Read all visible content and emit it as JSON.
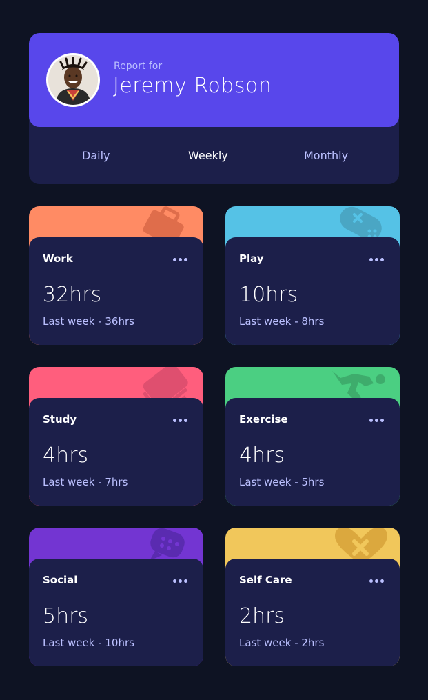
{
  "profile": {
    "report_label": "Report for",
    "name": "Jeremy Robson"
  },
  "tabs": [
    {
      "label": "Daily",
      "active": false
    },
    {
      "label": "Weekly",
      "active": true
    },
    {
      "label": "Monthly",
      "active": false
    }
  ],
  "colors": {
    "background": "#0e1323",
    "card": "#1c1f4a",
    "profile": "#5847eb",
    "pale_blue": "#bbc0ff"
  },
  "activities": [
    {
      "title": "Work",
      "current": "32hrs",
      "previous": "Last week - 36hrs",
      "color": "#ff8b64",
      "icon": "briefcase-icon"
    },
    {
      "title": "Play",
      "current": "10hrs",
      "previous": "Last week - 8hrs",
      "color": "#55c2e6",
      "icon": "gamepad-icon"
    },
    {
      "title": "Study",
      "current": "4hrs",
      "previous": "Last week - 7hrs",
      "color": "#ff5e7d",
      "icon": "book-icon"
    },
    {
      "title": "Exercise",
      "current": "4hrs",
      "previous": "Last week - 5hrs",
      "color": "#4bcf82",
      "icon": "running-icon"
    },
    {
      "title": "Social",
      "current": "5hrs",
      "previous": "Last week - 10hrs",
      "color": "#7335d2",
      "icon": "chat-icon"
    },
    {
      "title": "Self Care",
      "current": "2hrs",
      "previous": "Last week - 2hrs",
      "color": "#f1c75b",
      "icon": "heart-icon"
    }
  ]
}
